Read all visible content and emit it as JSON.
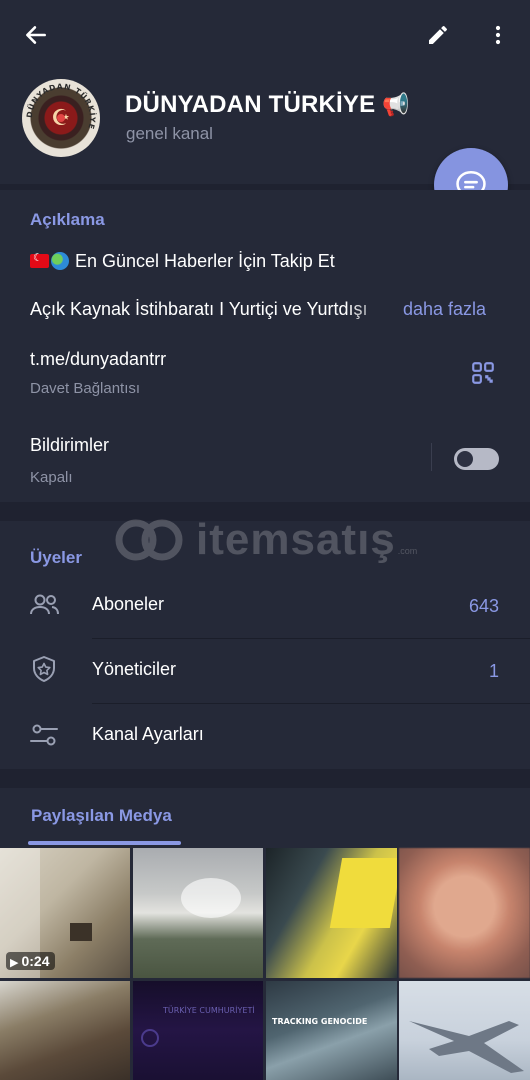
{
  "header": {
    "channel_name": "DÜNYADAN TÜRKİYE",
    "channel_emoji": "📢",
    "channel_type": "genel kanal",
    "avatar_ring_text": "DÜNYADAN TÜRKİYE",
    "icons": {
      "back": "arrow-left-icon",
      "edit": "pencil-icon",
      "more": "more-vertical-icon",
      "fab": "chat-bubble-icon"
    }
  },
  "about": {
    "title": "Açıklama",
    "line1": "En Güncel Haberler İçin Takip Et",
    "line2": "Açık Kaynak İstihbaratı I Yurtiçi ve Yurtdışı",
    "more_link": "daha fazla",
    "link": "t.me/dunyadantrr",
    "link_caption": "Davet Bağlantısı",
    "notifications_label": "Bildirimler",
    "notifications_state": "Kapalı",
    "notifications_on": false
  },
  "members": {
    "title": "Üyeler",
    "rows": [
      {
        "label": "Aboneler",
        "value": "643",
        "icon": "people-icon"
      },
      {
        "label": "Yöneticiler",
        "value": "1",
        "icon": "shield-star-icon"
      },
      {
        "label": "Kanal Ayarları",
        "value": "",
        "icon": "sliders-icon"
      }
    ]
  },
  "media": {
    "tab_label": "Paylaşılan Medya",
    "video_duration": "0:24",
    "thumb_labels": [
      "TÜRKİYE CUMHURİYETİ",
      "TRACKING GENOCIDE"
    ]
  },
  "watermark": {
    "brand": "itemsatış",
    "domain": ".com"
  }
}
